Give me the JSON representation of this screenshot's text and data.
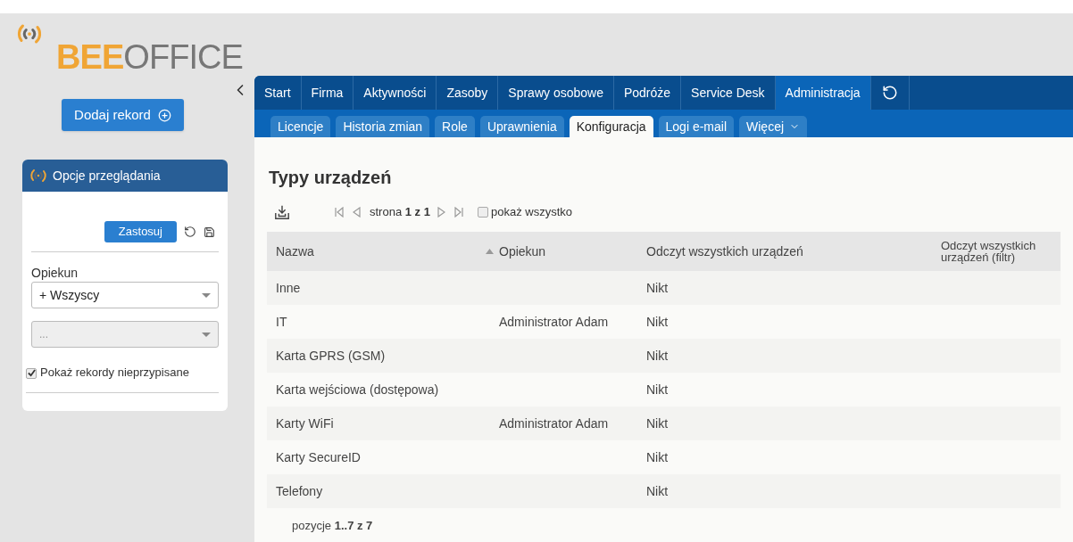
{
  "logo": {
    "accent": "BEE",
    "rest": "OFFICE"
  },
  "main_nav": [
    {
      "label": "Start",
      "selected": false
    },
    {
      "label": "Firma",
      "selected": false
    },
    {
      "label": "Aktywności",
      "selected": false
    },
    {
      "label": "Zasoby",
      "selected": false
    },
    {
      "label": "Sprawy osobowe",
      "selected": false
    },
    {
      "label": "Podróże",
      "selected": false
    },
    {
      "label": "Service Desk",
      "selected": false
    },
    {
      "label": "Administracja",
      "selected": true
    }
  ],
  "sub_nav": [
    {
      "label": "Licencje",
      "selected": false
    },
    {
      "label": "Historia zmian",
      "selected": false
    },
    {
      "label": "Role",
      "selected": false
    },
    {
      "label": "Uprawnienia",
      "selected": false
    },
    {
      "label": "Konfiguracja",
      "selected": true
    },
    {
      "label": "Logi e-mail",
      "selected": false
    },
    {
      "label": "Więcej",
      "selected": false,
      "dropdown": true
    }
  ],
  "sidebar": {
    "add_button": "Dodaj rekord",
    "panel_title": "Opcje przeglądania",
    "apply_button": "Zastosuj",
    "filter_label": "Opiekun",
    "filter_value": "+ Wszyscy",
    "second_placeholder": "...",
    "checkbox": {
      "label": "Pokaż rekordy nieprzypisane",
      "checked": true
    }
  },
  "page_title": "Typy urządzeń",
  "pager": {
    "prefix": "strona",
    "text": "**1 z 1**",
    "show_all": {
      "label": "pokaż wszystko",
      "checked": false
    }
  },
  "table": {
    "columns": [
      "Nazwa",
      "Opiekun",
      "Odczyt wszystkich urządzeń",
      "Odczyt wszystkich urządzeń (filtr)"
    ],
    "rows": [
      [
        "Inne",
        "",
        "Nikt",
        ""
      ],
      [
        "IT",
        "Administrator Adam",
        "Nikt",
        ""
      ],
      [
        "Karta GPRS (GSM)",
        "",
        "Nikt",
        ""
      ],
      [
        "Karta wejściowa (dostępowa)",
        "",
        "Nikt",
        ""
      ],
      [
        "Karty WiFi",
        "Administrator Adam",
        "Nikt",
        ""
      ],
      [
        "Karty SecureID",
        "",
        "Nikt",
        ""
      ],
      [
        "Telefony",
        "",
        "Nikt",
        ""
      ]
    ]
  },
  "footer": "pozycje **1..7 z 7**"
}
